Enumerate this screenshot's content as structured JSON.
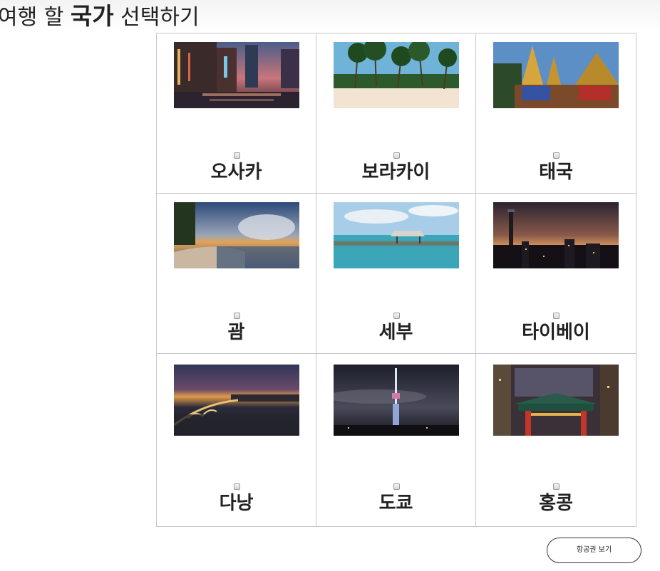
{
  "page": {
    "title_prefix": "여행 할",
    "title_strong": "국가",
    "title_suffix": "선택하기"
  },
  "destinations": [
    {
      "label": "오사카",
      "checked": false,
      "image": "osaka-canal-night-photo"
    },
    {
      "label": "보라카이",
      "checked": false,
      "image": "boracay-palm-beach-photo"
    },
    {
      "label": "태국",
      "checked": false,
      "image": "thai-temple-photo"
    },
    {
      "label": "괌",
      "checked": false,
      "image": "guam-sunset-beach-photo"
    },
    {
      "label": "세부",
      "checked": false,
      "image": "cebu-sea-hut-photo"
    },
    {
      "label": "타이베이",
      "checked": false,
      "image": "taipei-skyline-night-photo"
    },
    {
      "label": "다낭",
      "checked": false,
      "image": "danang-dragon-bridge-photo"
    },
    {
      "label": "도쿄",
      "checked": false,
      "image": "tokyo-skytree-night-photo"
    },
    {
      "label": "홍콩",
      "checked": false,
      "image": "hongkong-night-market-photo"
    }
  ],
  "actions": {
    "view_tickets_label": "항공권 보기"
  }
}
